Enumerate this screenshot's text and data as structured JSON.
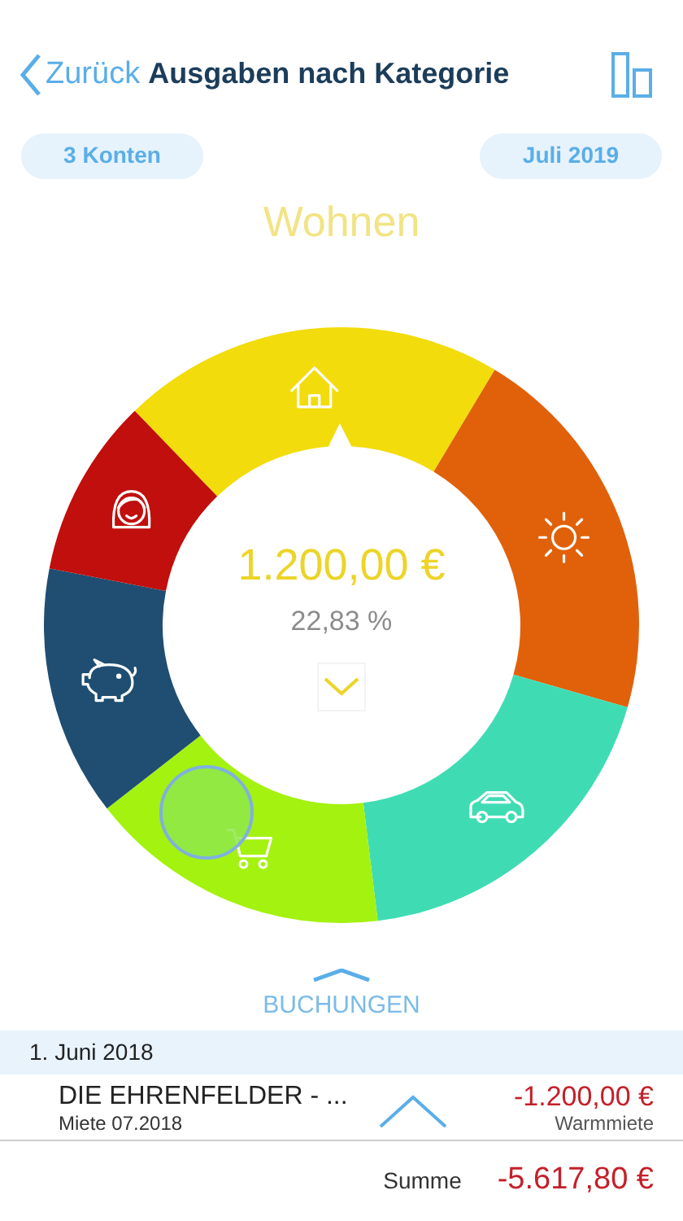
{
  "header": {
    "back": "Zurück",
    "title": "Ausgaben nach Kategorie"
  },
  "filters": [
    {
      "label": "3 Konten"
    },
    {
      "label": "Juli 2019"
    }
  ],
  "category": "Wohnen",
  "chart": {
    "amount": "1.200,00 €",
    "percent": "22,83 %",
    "segments": [
      {
        "kind": "house",
        "color": "#f2dc0c",
        "selected": true
      },
      {
        "kind": "sun",
        "color": "#e0610a",
        "selected": false
      },
      {
        "kind": "car",
        "color": "#3fdcb4",
        "selected": false
      },
      {
        "kind": "cart",
        "color": "#a4f20f",
        "selected": false
      },
      {
        "kind": "piggy",
        "color": "#1f4e72",
        "selected": false
      },
      {
        "kind": "face",
        "color": "#c00f0c",
        "selected": false
      }
    ]
  },
  "bookings": {
    "title": "BUCHUNGEN",
    "groups": [
      {
        "date": "1. Juni 2018",
        "items": [
          {
            "payee": "DIE EHRENFELDER - ...",
            "memo": "Miete 07.2018",
            "amount": "-1.200,00 €",
            "category": "Warmmiete"
          }
        ]
      }
    ]
  },
  "footer": {
    "label": "Summe",
    "total": "-5.617,80 €"
  }
}
